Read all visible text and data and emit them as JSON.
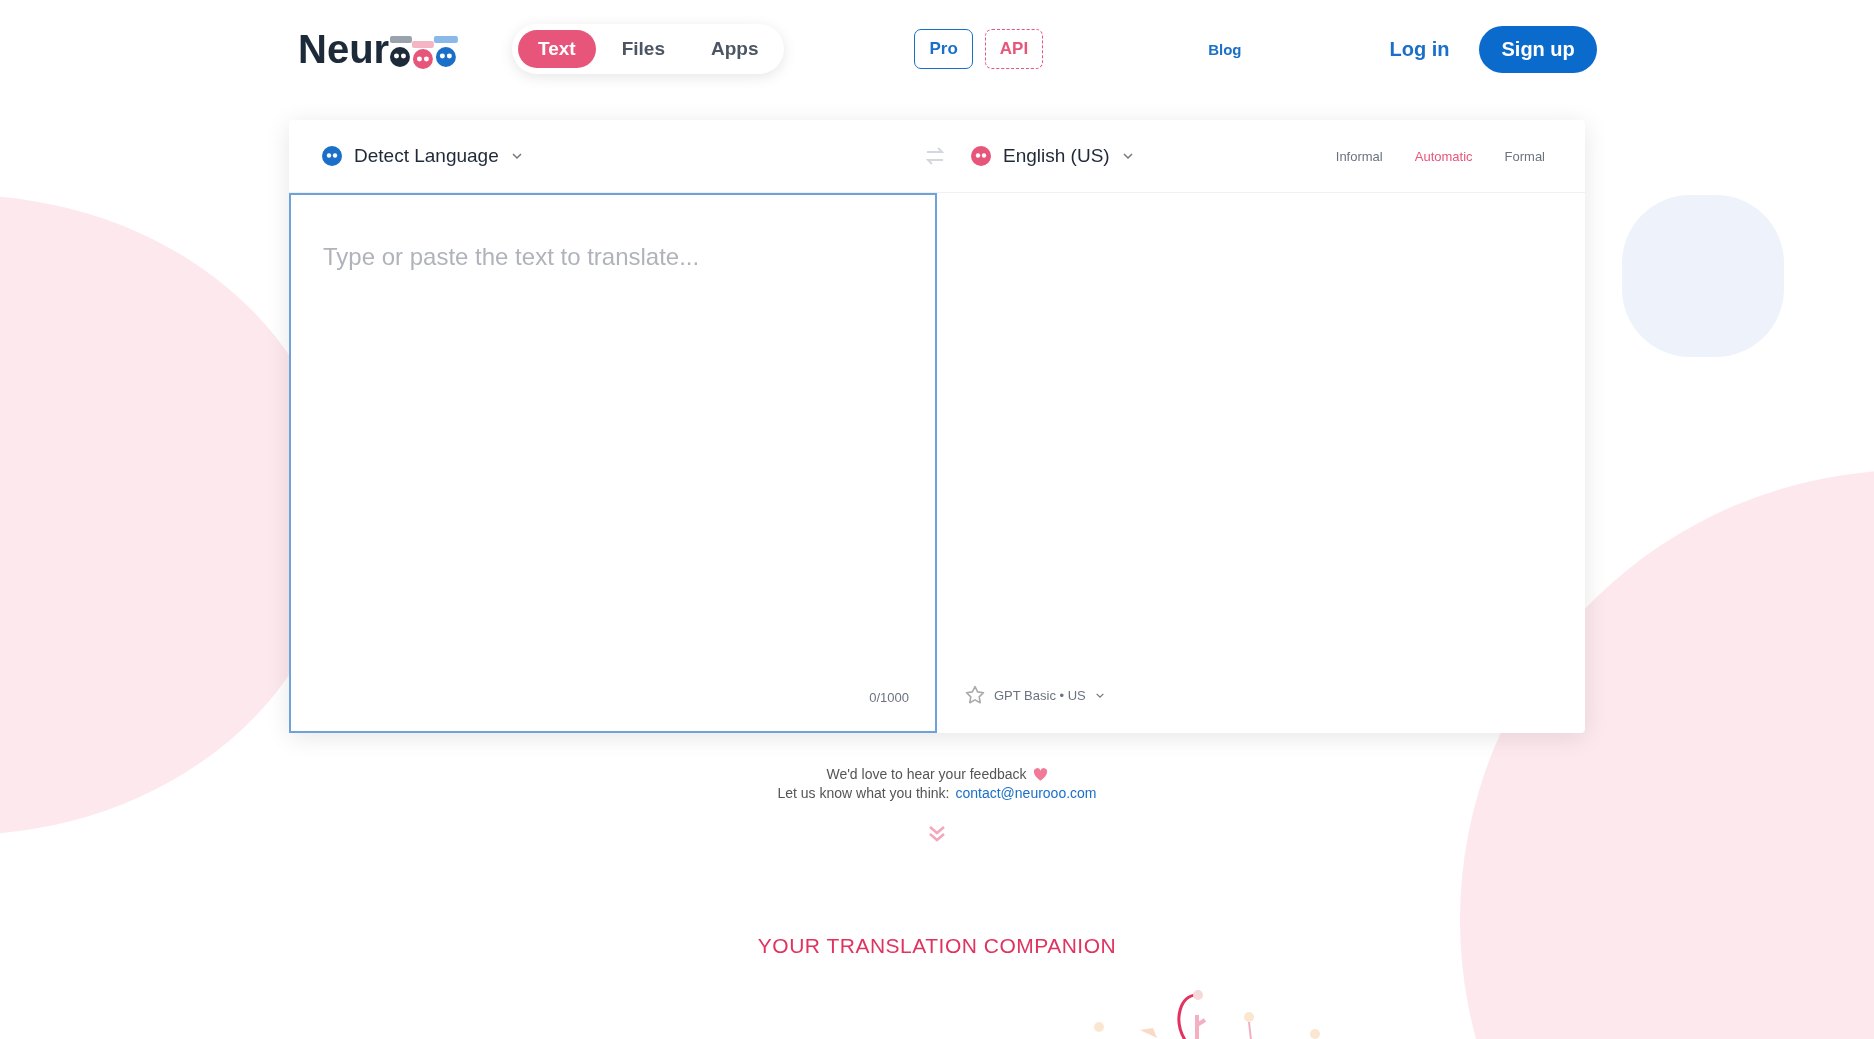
{
  "header": {
    "logo": "Neur",
    "tabs": [
      {
        "label": "Text",
        "selected": true
      },
      {
        "label": "Files",
        "selected": false
      },
      {
        "label": "Apps",
        "selected": false
      }
    ],
    "pro": "Pro",
    "api": "API",
    "blog": "Blog",
    "login": "Log in",
    "signup": "Sign up"
  },
  "translator": {
    "source_language": "Detect Language",
    "target_language": "English (US)",
    "formality": [
      {
        "label": "Informal",
        "selected": false
      },
      {
        "label": "Automatic",
        "selected": true
      },
      {
        "label": "Formal",
        "selected": false
      }
    ],
    "input": {
      "placeholder": "Type or paste the text to translate..."
    },
    "char_count": "0/1000",
    "model": "GPT Basic • US"
  },
  "feedback": {
    "line1": "We'd love to hear your feedback",
    "line2": "Let us know what you think:",
    "email": "contact@neurooo.com"
  },
  "section_title": "YOUR TRANSLATION COMPANION"
}
